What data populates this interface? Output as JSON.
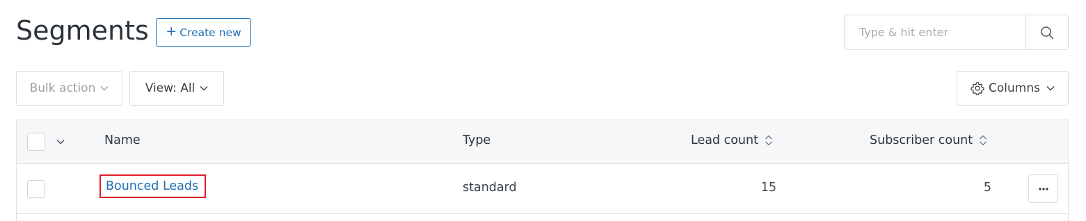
{
  "header": {
    "title": "Segments",
    "create_label": "Create new",
    "create_icon": "plus-icon"
  },
  "search": {
    "placeholder": "Type & hit enter",
    "value": "",
    "icon": "search-icon"
  },
  "toolbar": {
    "bulk_action_label": "Bulk action",
    "view_label": "View: All",
    "columns_label": "Columns"
  },
  "table": {
    "columns": [
      "Name",
      "Type",
      "Lead count",
      "Subscriber count"
    ],
    "rows": [
      {
        "name": "Bounced Leads",
        "type": "standard",
        "lead_count": "15",
        "subscriber_count": "5"
      }
    ]
  },
  "colors": {
    "accent": "#1f6fb2",
    "highlight_box": "#e11d2a",
    "header_bg": "#f6f7f9",
    "border": "#dee2e6"
  }
}
